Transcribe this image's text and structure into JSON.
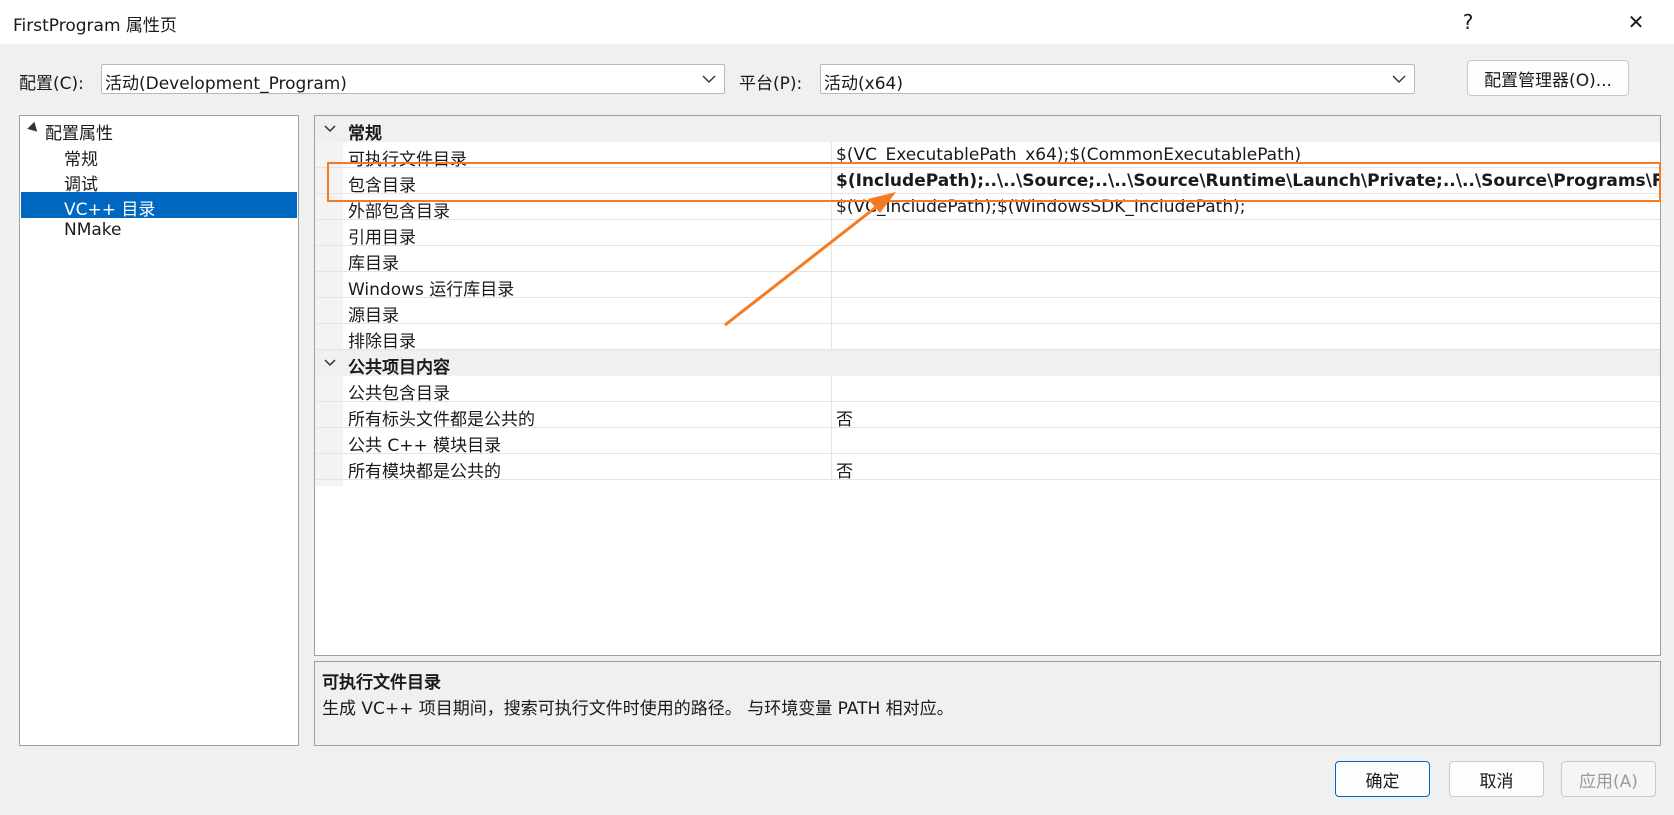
{
  "window": {
    "title": "FirstProgram 属性页",
    "help_label": "?",
    "close_label": "✕"
  },
  "config": {
    "config_label": "配置(C):",
    "config_value": "活动(Development_Program)",
    "platform_label": "平台(P):",
    "platform_value": "活动(x64)",
    "manager_button": "配置管理器(O)..."
  },
  "tree": {
    "root": "配置属性",
    "items": [
      "常规",
      "调试",
      "VC++ 目录",
      "NMake"
    ],
    "selected_index": 2
  },
  "grid": {
    "categories": [
      {
        "name": "常规",
        "rows": [
          {
            "name": "可执行文件目录",
            "value": "$(VC_ExecutablePath_x64);$(CommonExecutablePath)"
          },
          {
            "name": "包含目录",
            "value": "$(IncludePath);..\\..\\Source;..\\..\\Source\\Runtime\\Launch\\Private;..\\..\\Source\\Programs\\FirstP"
          },
          {
            "name": "外部包含目录",
            "value": "$(VC_IncludePath);$(WindowsSDK_IncludePath);"
          },
          {
            "name": "引用目录",
            "value": ""
          },
          {
            "name": "库目录",
            "value": ""
          },
          {
            "name": "Windows 运行库目录",
            "value": ""
          },
          {
            "name": "源目录",
            "value": ""
          },
          {
            "name": "排除目录",
            "value": ""
          }
        ]
      },
      {
        "name": "公共项目内容",
        "rows": [
          {
            "name": "公共包含目录",
            "value": ""
          },
          {
            "name": "所有标头文件都是公共的",
            "value": "否"
          },
          {
            "name": "公共 C++ 模块目录",
            "value": ""
          },
          {
            "name": "所有模块都是公共的",
            "value": "否"
          }
        ]
      }
    ]
  },
  "description": {
    "title": "可执行文件目录",
    "text": "生成 VC++ 项目期间，搜索可执行文件时使用的路径。  与环境变量 PATH 相对应。"
  },
  "buttons": {
    "ok": "确定",
    "cancel": "取消",
    "apply": "应用(A)"
  },
  "colors": {
    "highlight": "#f47b20",
    "selection": "#0067c0"
  }
}
